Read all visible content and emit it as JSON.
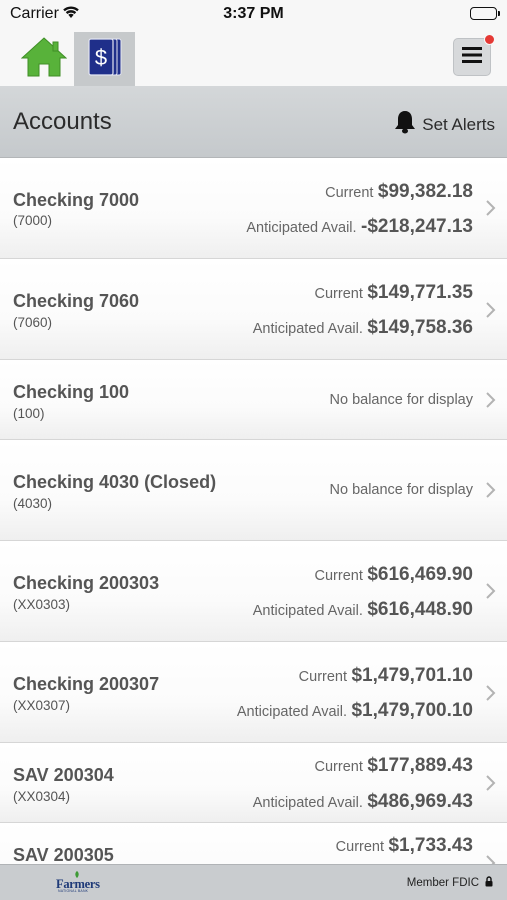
{
  "status_bar": {
    "carrier": "Carrier",
    "time": "3:37 PM"
  },
  "tabs": [
    {
      "icon": "home-icon",
      "selected": false
    },
    {
      "icon": "accounts-dollar-icon",
      "selected": true
    }
  ],
  "menu": {
    "icon": "hamburger-menu-icon",
    "has_notification": true,
    "notification_color": "#e53935"
  },
  "header": {
    "title": "Accounts",
    "alerts_label": "Set Alerts",
    "alerts_icon": "bell-icon"
  },
  "accounts": [
    {
      "name": "Checking 7000",
      "number": "(7000)",
      "current_label": "Current",
      "current": "$99,382.18",
      "anticipated_label": "Anticipated Avail.",
      "anticipated": "-$218,247.13"
    },
    {
      "name": "Checking 7060",
      "number": "(7060)",
      "current_label": "Current",
      "current": "$149,771.35",
      "anticipated_label": "Anticipated Avail.",
      "anticipated": "$149,758.36"
    },
    {
      "name": "Checking 100",
      "number": "(100)",
      "no_balance": "No balance for display"
    },
    {
      "name": "Checking 4030 (Closed)",
      "number": "(4030)",
      "no_balance": "No balance for display"
    },
    {
      "name": "Checking 200303",
      "number": "(XX0303)",
      "current_label": "Current",
      "current": "$616,469.90",
      "anticipated_label": "Anticipated Avail.",
      "anticipated": "$616,448.90"
    },
    {
      "name": "Checking 200307",
      "number": "(XX0307)",
      "current_label": "Current",
      "current": "$1,479,701.10",
      "anticipated_label": "Anticipated Avail.",
      "anticipated": "$1,479,700.10"
    },
    {
      "name": "SAV 200304",
      "number": "(XX0304)",
      "current_label": "Current",
      "current": "$177,889.43",
      "anticipated_label": "Anticipated Avail.",
      "anticipated": "$486,969.43"
    },
    {
      "name": "SAV 200305",
      "number": "",
      "current_label": "Current",
      "current": "$1,733.43"
    }
  ],
  "footer": {
    "logo_text": "Farmers",
    "logo_sub": "NATIONAL BANK",
    "fdic_label": "Member FDIC",
    "fdic_icon": "lock-icon"
  },
  "colors": {
    "brand_navy": "#1f2f8a",
    "home_green": "#58b23a",
    "header_gray": "#c9ccce"
  }
}
